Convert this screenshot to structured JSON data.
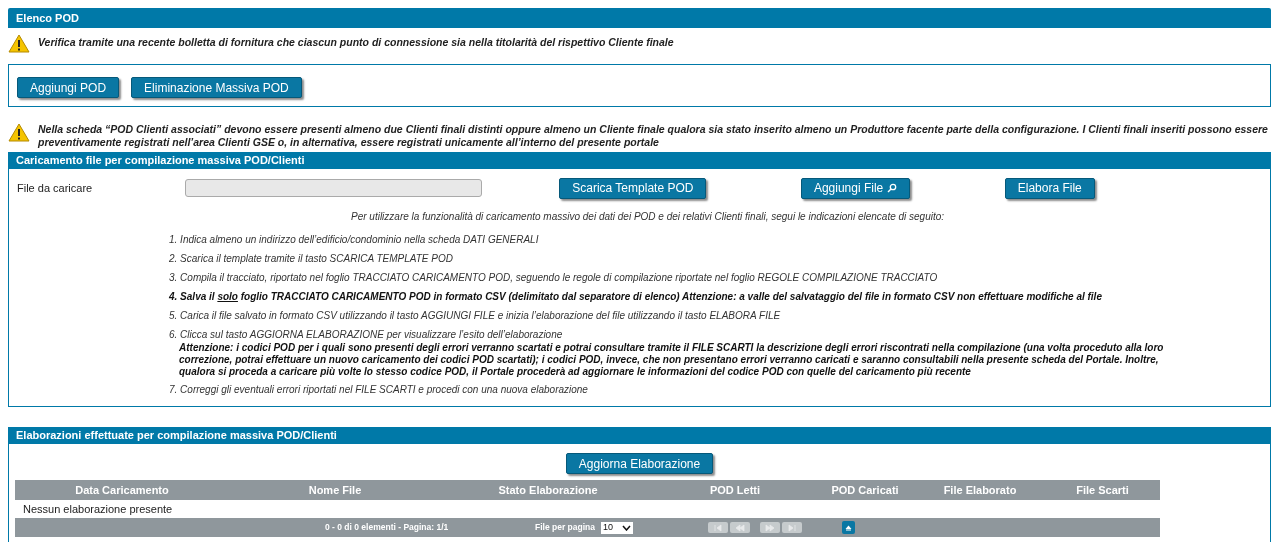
{
  "header": {
    "title": "Elenco POD"
  },
  "warning_1": "Verifica tramite una recente bolletta di fornitura che ciascun punto di connessione sia nella titolarità del rispettivo Cliente finale",
  "pod_buttons": [
    "Aggiungi POD",
    "Eliminazione Massiva POD"
  ],
  "warning_2": "Nella scheda “POD Clienti associati” devono essere presenti almeno due Clienti finali distinti oppure almeno un Cliente finale qualora sia stato inserito almeno un Produttore facente parte della configurazione. I Clienti finali inseriti possono essere preventivamente registrati nell’area Clienti GSE o, in alternativa, essere registrati unicamente all’interno del presente portale",
  "upload": {
    "title": "Caricamento file per compilazione massiva POD/Clienti",
    "file_label": "File da caricare",
    "buttons": [
      {
        "label": "Scarica Template POD",
        "kind": "plain"
      },
      {
        "label": "Aggiungi File",
        "kind": "browse"
      },
      {
        "label": "Elabora File",
        "kind": "plain"
      }
    ],
    "intro": "Per utilizzare la funzionalità di caricamento massivo dei dati dei POD e dei relativi Clienti finali, segui le indicazioni elencate di seguito:",
    "steps": [
      {
        "text": "1. Indica almeno un indirizzo dell’edificio/condominio nella scheda DATI GENERALI",
        "bold": false
      },
      {
        "text": "2. Scarica il template tramite il tasto SCARICA TEMPLATE POD",
        "bold": false
      },
      {
        "text": "3. Compila il tracciato, riportato nel foglio TRACCIATO CARICAMENTO POD, seguendo le regole di compilazione riportate nel foglio REGOLE COMPILAZIONE TRACCIATO",
        "bold": false
      },
      {
        "parts": [
          {
            "text": "4. Salva il ",
            "underline": false
          },
          {
            "text": "solo",
            "underline": true
          },
          {
            "text": " foglio TRACCIATO CARICAMENTO POD in formato CSV (delimitato dal separatore di elenco) Attenzione: a valle del salvataggio del file in formato CSV non effettuare modifiche al file",
            "underline": false
          }
        ],
        "bold": true
      },
      {
        "text": "5. Carica il file salvato in formato CSV utilizzando il tasto AGGIUNGI FILE e inizia l’elaborazione del file utilizzando il tasto ELABORA FILE",
        "bold": false
      },
      {
        "text": "6. Clicca sul tasto AGGIORNA ELABORAZIONE per visualizzare l’esito dell’elaborazione",
        "bold": false,
        "note": "Attenzione: i codici POD per i quali sono presenti degli errori verranno scartati e potrai consultare tramite il FILE SCARTI la descrizione degli errori riscontrati nella compilazione (una volta proceduto alla loro correzione, potrai effettuare un nuovo caricamento dei codici POD scartati); i codici POD, invece, che non presentano errori verranno caricati e saranno consultabili nella presente scheda del Portale. Inoltre, qualora si proceda a caricare più volte lo stesso codice POD, il Portale procederà ad aggiornare le informazioni del codice POD con quelle del caricamento più recente"
      },
      {
        "text": "7. Correggi gli eventuali errori riportati nel FILE SCARTI e procedi con una nuova elaborazione",
        "bold": false
      }
    ]
  },
  "results": {
    "title": "Elaborazioni effettuate per compilazione massiva POD/Clienti",
    "refresh_button": "Aggiorna Elaborazione",
    "columns": [
      "Data Caricamento",
      "Nome File",
      "Stato Elaborazione",
      "POD Letti",
      "POD Caricati",
      "File Elaborato",
      "File Scarti"
    ],
    "empty_message": "Nessun elaborazione presente",
    "pager": {
      "summary": "0 - 0 di 0 elementi - Pagina: 1/1",
      "page_size_label": "File per pagina",
      "page_size": "10",
      "nav": [
        {
          "kind": "first",
          "disabled": true
        },
        {
          "kind": "prev",
          "disabled": true
        },
        {
          "kind": "next",
          "disabled": true
        },
        {
          "kind": "last",
          "disabled": true
        }
      ]
    }
  }
}
